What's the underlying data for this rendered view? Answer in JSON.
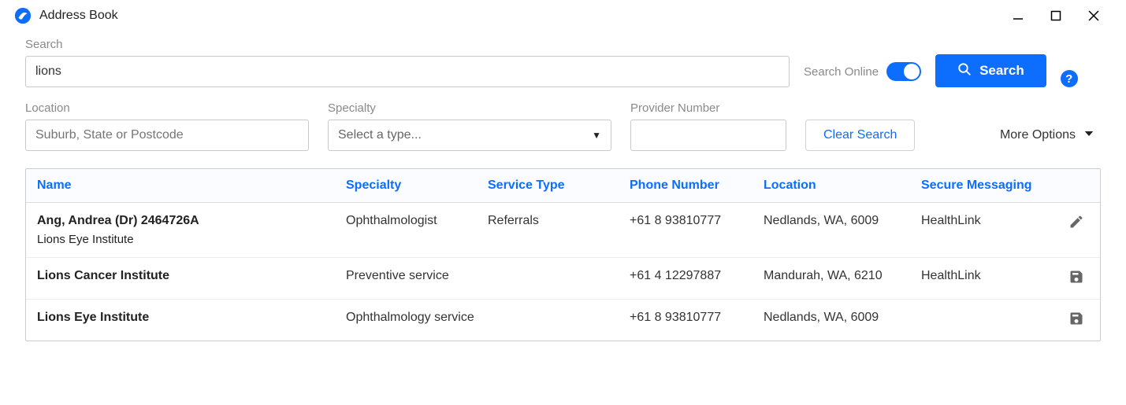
{
  "window": {
    "title": "Address Book"
  },
  "search": {
    "label": "Search",
    "value": "lions",
    "search_online_label": "Search Online",
    "search_online_on": true,
    "search_button": "Search"
  },
  "filters": {
    "location_label": "Location",
    "location_placeholder": "Suburb, State or Postcode",
    "location_value": "",
    "specialty_label": "Specialty",
    "specialty_placeholder": "Select a type...",
    "specialty_value": "",
    "provider_label": "Provider Number",
    "provider_value": "",
    "clear_button": "Clear Search",
    "more_options": "More Options"
  },
  "columns": {
    "name": "Name",
    "specialty": "Specialty",
    "service_type": "Service Type",
    "phone": "Phone Number",
    "location": "Location",
    "secure_messaging": "Secure Messaging"
  },
  "rows": [
    {
      "name": "Ang, Andrea (Dr) 2464726A",
      "subname": "Lions Eye Institute",
      "specialty": "Ophthalmologist",
      "service_type": "Referrals",
      "phone": "+61 8 93810777",
      "location": "Nedlands, WA, 6009",
      "secure_messaging": "HealthLink",
      "action": "edit"
    },
    {
      "name": "Lions Cancer Institute",
      "subname": "",
      "specialty": "Preventive service",
      "service_type": "",
      "phone": "+61 4 12297887",
      "location": "Mandurah, WA, 6210",
      "secure_messaging": "HealthLink",
      "action": "save"
    },
    {
      "name": "Lions Eye Institute",
      "subname": "",
      "specialty": "Ophthalmology service",
      "service_type": "",
      "phone": "+61 8 93810777",
      "location": "Nedlands, WA, 6009",
      "secure_messaging": "",
      "action": "save"
    }
  ]
}
